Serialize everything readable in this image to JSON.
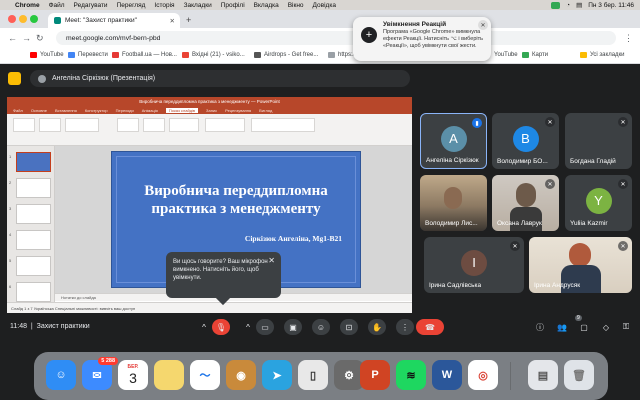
{
  "menubar": {
    "apple": "",
    "items": [
      "Chrome",
      "Файл",
      "Редагувати",
      "Перегляд",
      "Історія",
      "Закладки",
      "Профілі",
      "Вкладка",
      "Вікно",
      "Довідка"
    ],
    "clock": "Пн 3 бер. 11:46"
  },
  "tab": {
    "title": "Meet: \"Захист практики\"",
    "close": "✕",
    "new": "+"
  },
  "address": {
    "url": "meet.google.com/mvf-bern-pbd"
  },
  "bookmarks": {
    "items": [
      "YouTube",
      "Перевести",
      "Football.ua — Нов...",
      "Вхідні (21) - vsiko...",
      "Airdrops - Get free...",
      "https://w"
    ],
    "right": [
      "YouTube",
      "Карти"
    ],
    "all": "Усі закладки"
  },
  "meet": {
    "presenter_label": "Ангеліна Сіркізюк (Презентація)",
    "meeting_name": "Захист практики",
    "time": "11:48",
    "people_count": "9"
  },
  "slide": {
    "title": "Виробнича переддипломна практика з менеджменту",
    "subtitle": "Сіркізюк Ангеліна, Mg1-B21",
    "notes_placeholder": "Нотатки до слайда",
    "status": "Слайд 1 з 7   Українська   Спеціальні можливості: вивчіть ваш доступ",
    "titlebar": "Виробнича переддипломна практика з менеджменту — PowerPoint"
  },
  "mic_tooltip": {
    "text": "Ви щось говорите? Ваш мікрофон вимкнено. Натисніть його, щоб увімкнути.",
    "close": "✕"
  },
  "participants": [
    {
      "name": "Ангеліна Сіркізюк",
      "initial": "A",
      "color": "#5b8fa8"
    },
    {
      "name": "Володимир БО...",
      "initial": "B",
      "color": "#1e88e5"
    },
    {
      "name": "Богдана Гладій",
      "initial": "",
      "color": ""
    },
    {
      "name": "Володимир Лис...",
      "initial": "",
      "color": ""
    },
    {
      "name": "Оксана Лаврук",
      "initial": "",
      "color": ""
    },
    {
      "name": "Yuliia Kazmir",
      "initial": "Y",
      "color": "#7cb342"
    },
    {
      "name": "Ірина Садлівська",
      "initial": "I",
      "color": "#6d4c41"
    },
    {
      "name": "Ірина Андрусяк",
      "initial": "",
      "color": ""
    }
  ],
  "notification": {
    "title": "Увімкнення Реакцій",
    "body": "Програма «Google Chrome» вимкнула ефекти Реакції. Натисніть ⌥ і виберіть «Реакції», щоб увімкнути свої жести.",
    "icon": "+"
  },
  "dock": {
    "mail_badge": "5 288",
    "calendar_month": "БЕР.",
    "calendar_day": "3"
  },
  "colors": {
    "meet_bg": "#1e1f20",
    "slide_blue": "#4472c4",
    "powerpoint_red": "#b7472a",
    "end_call_red": "#ea4335",
    "active_border": "#8ab4f8"
  }
}
